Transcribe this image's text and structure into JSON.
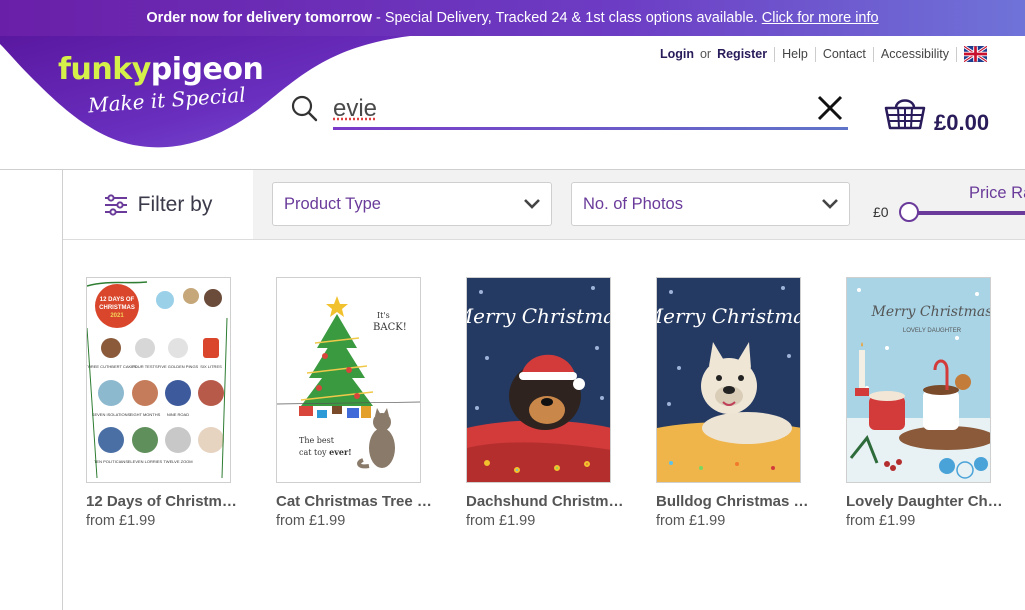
{
  "banner": {
    "bold": "Order now for delivery tomorrow",
    "rest": "- Special Delivery, Tracked 24 & 1st class options available.",
    "link": "Click for more info"
  },
  "logo": {
    "funky": "funky",
    "pigeon": "pigeon",
    "tagline": "Make it Special"
  },
  "top_links": {
    "login": "Login",
    "or": "or",
    "register": "Register",
    "help": "Help",
    "contact": "Contact",
    "accessibility": "Accessibility"
  },
  "search": {
    "value": "evie"
  },
  "basket": {
    "total": "£0.00"
  },
  "filters": {
    "filter_by": "Filter by",
    "product_type": "Product Type",
    "photos": "No. of Photos",
    "price_range": "Price Ra",
    "price_min": "£0",
    "price_min_value": 0
  },
  "products": [
    {
      "name": "12 Days of Christm…",
      "price": "from £1.99"
    },
    {
      "name": "Cat Christmas Tree …",
      "price": "from £1.99"
    },
    {
      "name": "Dachshund Christm…",
      "price": "from £1.99"
    },
    {
      "name": "Bulldog Christmas …",
      "price": "from £1.99"
    },
    {
      "name": "Lovely Daughter Ch…",
      "price": "from £1.99"
    }
  ],
  "card_text": {
    "days_title": "12 DAYS OF CHRISTMAS 2021",
    "cat_top": "It's BACK!",
    "cat_bottom": "The best cat toy ever!",
    "merry": "Merry Christmas",
    "lovely": "LOVELY DAUGHTER"
  },
  "colors": {
    "brand_purple": "#6a1fa8",
    "accent_lime": "#d6f04a",
    "text_purple": "#6a3b9a"
  }
}
